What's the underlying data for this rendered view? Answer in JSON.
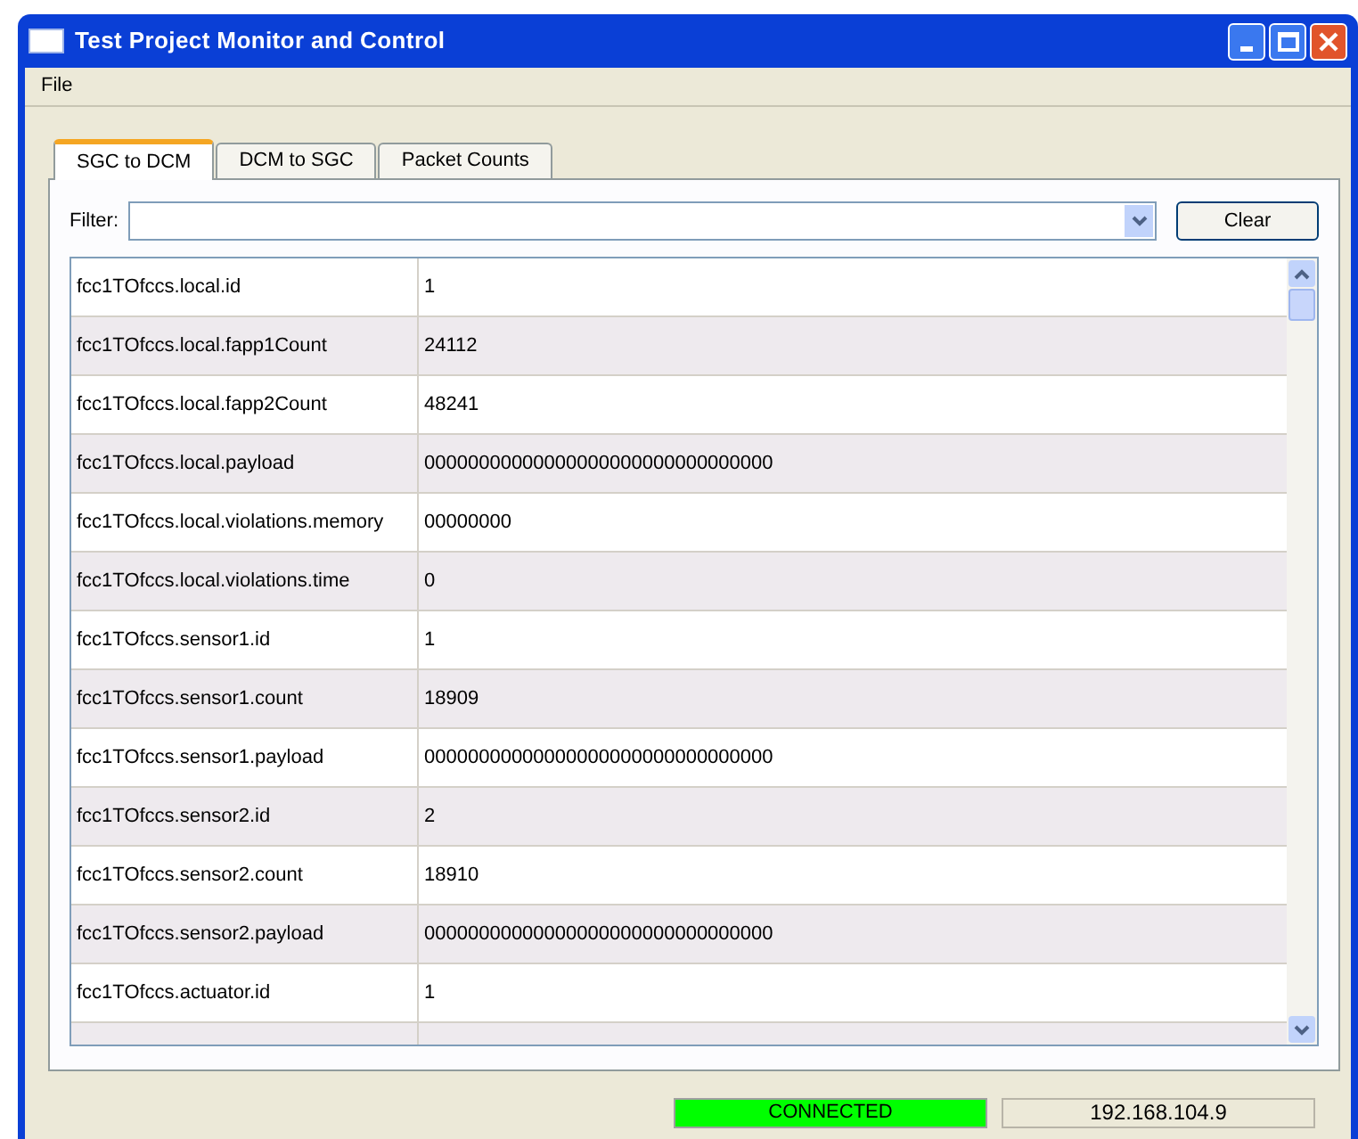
{
  "window": {
    "title": "Test Project Monitor and Control"
  },
  "menu": [
    "File"
  ],
  "tabs": [
    {
      "label": "SGC to DCM",
      "selected": true
    },
    {
      "label": "DCM to SGC",
      "selected": false
    },
    {
      "label": "Packet Counts",
      "selected": false
    }
  ],
  "filter": {
    "label": "Filter:",
    "button": "Clear"
  },
  "table": {
    "rows": [
      {
        "name": "fcc1TOfccs.local.id",
        "value": "1"
      },
      {
        "name": "fcc1TOfccs.local.fapp1Count",
        "value": "24112"
      },
      {
        "name": "fcc1TOfccs.local.fapp2Count",
        "value": "48241"
      },
      {
        "name": "fcc1TOfccs.local.payload",
        "value": "00000000000000000000000000000000"
      },
      {
        "name": "fcc1TOfccs.local.violations.memory",
        "value": "00000000"
      },
      {
        "name": "fcc1TOfccs.local.violations.time",
        "value": "0"
      },
      {
        "name": "fcc1TOfccs.sensor1.id",
        "value": "1"
      },
      {
        "name": "fcc1TOfccs.sensor1.count",
        "value": "18909"
      },
      {
        "name": "fcc1TOfccs.sensor1.payload",
        "value": "00000000000000000000000000000000"
      },
      {
        "name": "fcc1TOfccs.sensor2.id",
        "value": "2"
      },
      {
        "name": "fcc1TOfccs.sensor2.count",
        "value": "18910"
      },
      {
        "name": "fcc1TOfccs.sensor2.payload",
        "value": "00000000000000000000000000000000"
      },
      {
        "name": "fcc1TOfccs.actuator.id",
        "value": "1"
      }
    ]
  },
  "status_bar": {
    "connection": {
      "text": "CONNECTED",
      "connected": true
    },
    "address": "192.168.104.9"
  }
}
